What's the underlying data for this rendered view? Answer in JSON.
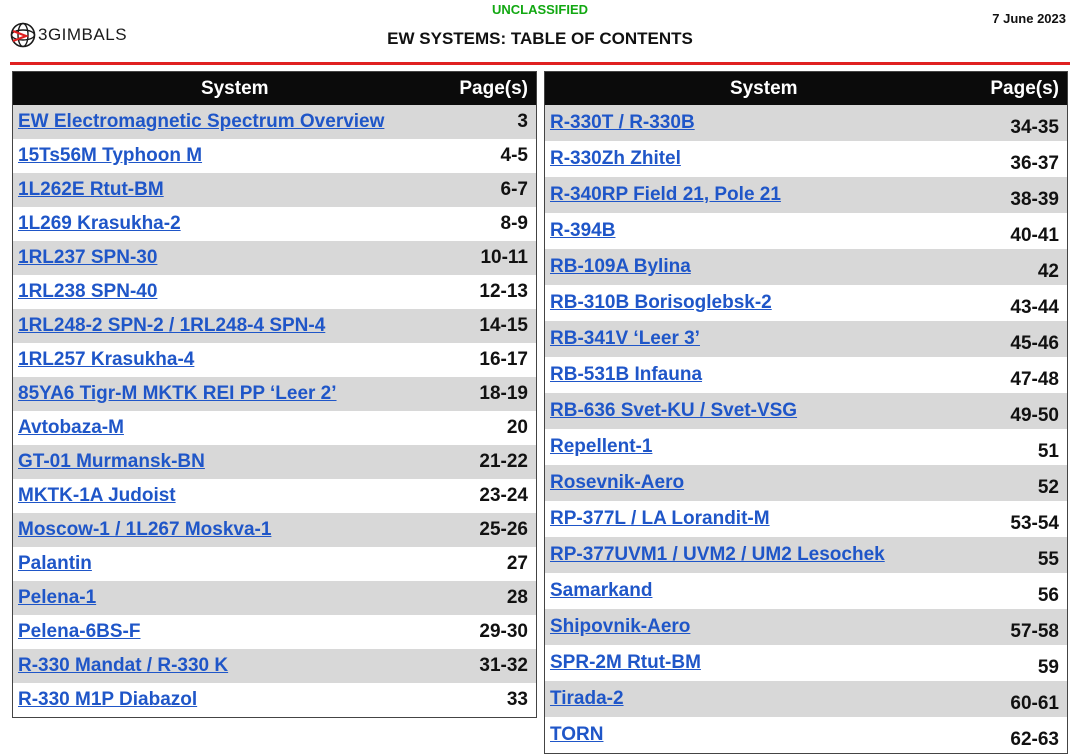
{
  "header": {
    "classification": "UNCLASSIFIED",
    "title": "EW SYSTEMS: TABLE OF CONTENTS",
    "date": "7 June 2023",
    "logo_text": "3GIMBALS",
    "accent_color": "#e02020",
    "classification_color": "#12a812",
    "link_color": "#1f56c8"
  },
  "columns": {
    "system": "System",
    "pages": "Page(s)"
  },
  "left_table": [
    {
      "system": "EW Electromagnetic Spectrum Overview",
      "pages": "3"
    },
    {
      "system": "15Ts56M Typhoon M",
      "pages": "4-5"
    },
    {
      "system": "1L262E Rtut-BM",
      "pages": "6-7"
    },
    {
      "system": "1L269 Krasukha-2",
      "pages": "8-9"
    },
    {
      "system": "1RL237 SPN-30",
      "pages": "10-11"
    },
    {
      "system": "1RL238 SPN-40",
      "pages": "12-13"
    },
    {
      "system": "1RL248-2 SPN-2 / 1RL248-4 SPN-4",
      "pages": "14-15"
    },
    {
      "system": "1RL257 Krasukha-4",
      "pages": "16-17"
    },
    {
      "system": "85YA6 Tigr-M MKTK REI PP ‘Leer 2’",
      "pages": "18-19"
    },
    {
      "system": "Avtobaza-M",
      "pages": "20"
    },
    {
      "system": "GT-01 Murmansk-BN",
      "pages": "21-22"
    },
    {
      "system": "MKTK-1A Judoist",
      "pages": "23-24"
    },
    {
      "system": "Moscow-1 / 1L267 Moskva-1",
      "pages": "25-26"
    },
    {
      "system": "Palantin",
      "pages": "27"
    },
    {
      "system": "Pelena-1",
      "pages": "28"
    },
    {
      "system": "Pelena-6BS-F",
      "pages": "29-30"
    },
    {
      "system": "R-330 Mandat / R-330 K",
      "pages": "31-32"
    },
    {
      "system": "R-330 M1P Diabazol",
      "pages": "33"
    }
  ],
  "right_table": [
    {
      "system": "R-330T / R-330B",
      "pages": "34-35"
    },
    {
      "system": "R-330Zh Zhitel",
      "pages": "36-37"
    },
    {
      "system": "R-340RP Field 21, Pole 21",
      "pages": "38-39"
    },
    {
      "system": "R-394B",
      "pages": "40-41"
    },
    {
      "system": "RB-109A Bylina",
      "pages": "42"
    },
    {
      "system": "RB-310B Borisoglebsk-2",
      "pages": "43-44"
    },
    {
      "system": "RB-341V ‘Leer 3’",
      "pages": "45-46"
    },
    {
      "system": "RB-531B Infauna",
      "pages": "47-48"
    },
    {
      "system": "RB-636 Svet-KU / Svet-VSG",
      "pages": "49-50"
    },
    {
      "system": "Repellent-1",
      "pages": "51"
    },
    {
      "system": "Rosevnik-Aero",
      "pages": "52"
    },
    {
      "system": "RP-377L / LA Lorandit-M",
      "pages": "53-54"
    },
    {
      "system": "RP-377UVM1 / UVM2 / UM2 Lesochek",
      "pages": "55"
    },
    {
      "system": "Samarkand",
      "pages": "56"
    },
    {
      "system": "Shipovnik-Aero",
      "pages": "57-58"
    },
    {
      "system": "SPR-2M Rtut-BM",
      "pages": "59"
    },
    {
      "system": "Tirada-2",
      "pages": "60-61"
    },
    {
      "system": "TORN",
      "pages": "62-63"
    }
  ]
}
